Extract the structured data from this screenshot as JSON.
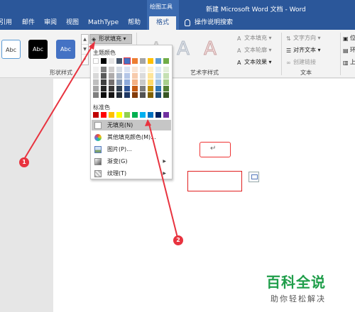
{
  "titlebar": {
    "context_group": "绘图工具",
    "doc_title": "新建 Microsoft Word 文档 - Word",
    "tabs": [
      "引用",
      "邮件",
      "审阅",
      "视图",
      "MathType",
      "帮助"
    ],
    "active_tab": "格式",
    "tell_me": "操作说明搜索"
  },
  "ribbon": {
    "shape_styles": {
      "swatch_label": "Abc",
      "group_label": "形状样式",
      "fill_button": "形状填充"
    },
    "wordart": {
      "glyph": "A",
      "group_label": "艺术字样式",
      "text_fill": "文本填充",
      "text_outline": "文本轮廓",
      "text_effects": "文本效果"
    },
    "text_group": {
      "direction": "文字方向",
      "align": "对齐文本",
      "link": "创建链接",
      "group_label": "文本"
    },
    "arrange": {
      "position": "位置",
      "wrap": "环绕",
      "forward": "上移"
    }
  },
  "fill_menu": {
    "theme_colors_label": "主题颜色",
    "standard_colors_label": "标准色",
    "theme_top": [
      "#ffffff",
      "#000000",
      "#e7e6e6",
      "#44546a",
      "#4472c4",
      "#ed7d31",
      "#a5a5a5",
      "#ffc000",
      "#5b9bd5",
      "#70ad47"
    ],
    "theme_shades": [
      [
        "#f2f2f2",
        "#7f7f7f",
        "#d0cece",
        "#d6dce4",
        "#d9e2f3",
        "#fbe5d5",
        "#ededed",
        "#fff2cc",
        "#deebf6",
        "#e2efd9"
      ],
      [
        "#d8d8d8",
        "#595959",
        "#aeabab",
        "#adb9ca",
        "#b4c6e7",
        "#f7cbac",
        "#dbdbdb",
        "#fee599",
        "#bdd7ee",
        "#c5e0b3"
      ],
      [
        "#bfbfbf",
        "#3f3f3f",
        "#757070",
        "#8496b0",
        "#8eaadb",
        "#f4b183",
        "#c9c9c9",
        "#ffd965",
        "#9cc3e5",
        "#a8d08d"
      ],
      [
        "#a5a5a5",
        "#262626",
        "#3a3838",
        "#323f4f",
        "#2f5496",
        "#c55a11",
        "#7b7b7b",
        "#bf9000",
        "#2e75b5",
        "#538135"
      ],
      [
        "#7f7f7f",
        "#0c0c0c",
        "#171616",
        "#222a35",
        "#1f3864",
        "#833c0b",
        "#525252",
        "#7f6000",
        "#1e4e79",
        "#375623"
      ]
    ],
    "standard": [
      "#c00000",
      "#ff0000",
      "#ffc000",
      "#ffff00",
      "#92d050",
      "#00b050",
      "#00b0f0",
      "#0070c0",
      "#002060",
      "#7030a0"
    ],
    "no_fill": "无填充(N)",
    "more_colors": "其他填充颜色(M)...",
    "picture": "图片(P)...",
    "gradient": "渐变(G)",
    "texture": "纹理(T)"
  },
  "document": {
    "paragraph_mark": "↵"
  },
  "annotations": [
    "1",
    "2"
  ],
  "watermark": {
    "title": "百科全说",
    "subtitle": "助你轻松解决"
  },
  "colors": {
    "word_blue": "#2b579a",
    "annotation_red": "#e8333f",
    "watermark_green": "#1f9e4a"
  }
}
